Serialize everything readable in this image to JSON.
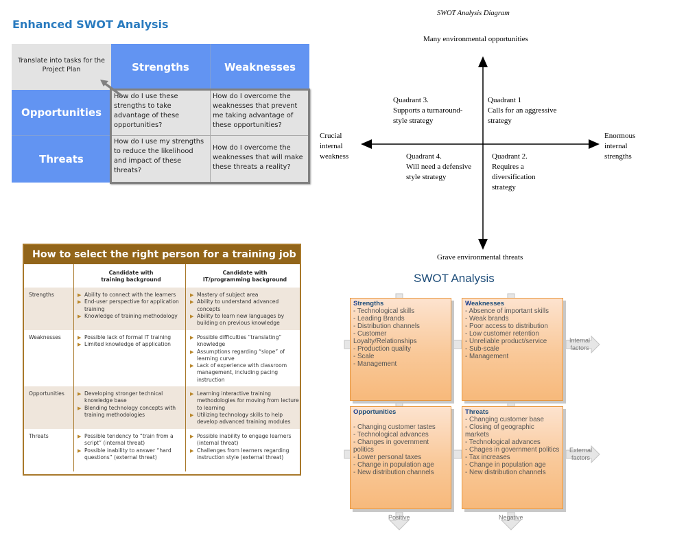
{
  "enhanced_swot": {
    "title": "Enhanced SWOT Analysis",
    "corner_note": "Translate into tasks for the Project Plan",
    "col_headers": [
      "Strengths",
      "Weaknesses"
    ],
    "row_headers": [
      "Opportunities",
      "Threats"
    ],
    "cells": {
      "strengths_opportunities": "How do I use these strengths to take advantage of these opportunities?",
      "weaknesses_opportunities": "How do I overcome the weaknesses that prevent me taking advantage of these opportunities?",
      "strengths_threats": "How do I use my strengths to reduce the likelihood and impact of these threats?",
      "weaknesses_threats": "How do I overcome the weaknesses that will make these threats a reality?"
    },
    "colors": {
      "header_blue": "#6294f2",
      "cell_grey": "#e3e3e3",
      "title_blue": "#2a7bbf"
    }
  },
  "swot_diagram": {
    "title": "SWOT Analysis Diagram",
    "axis_top": "Many environmental opportunities",
    "axis_bottom": "Grave environmental threats",
    "axis_left": [
      "Crucial",
      "internal",
      "weakness"
    ],
    "axis_right": [
      "Enormous",
      "internal",
      "strengths"
    ],
    "quadrants": {
      "q1": [
        "Quadrant 1",
        "Calls for an aggressive",
        "strategy"
      ],
      "q2": [
        "Quadrant 2.",
        "Requires a",
        "diversification",
        "strategy"
      ],
      "q3": [
        "Quadrant 3.",
        "Supports a turnaround-",
        "style strategy"
      ],
      "q4": [
        "Quadrant 4.",
        "Will need a defensive",
        "style strategy"
      ]
    }
  },
  "training_table": {
    "title": "How to select the right person for a training job",
    "col_headers": [
      [
        "Candidate with",
        "training background"
      ],
      [
        "Candidate with",
        "IT/programming background"
      ]
    ],
    "rows": [
      {
        "label": "Strengths",
        "training": [
          "Ability to connect with the learners",
          "End-user perspective for application training",
          "Knowledge of training methodology"
        ],
        "it": [
          "Mastery of subject area",
          "Ability to understand advanced concepts",
          "Ability to learn new languages by building on previous knowledge"
        ]
      },
      {
        "label": "Weaknesses",
        "training": [
          "Possible lack of formal IT training",
          "Limited knowledge of application"
        ],
        "it": [
          "Possible difficulties “translating” knowledge",
          "Assumptions regarding “slope” of learning curve",
          "Lack of experience with classroom management, including pacing instruction"
        ]
      },
      {
        "label": "Opportunities",
        "training": [
          "Developing stronger technical knowledge base",
          "Blending technology concepts with training methodologies"
        ],
        "it": [
          "Learning interactive training methodologies for moving from lecture to learning",
          "Utilizing technology skills to help develop advanced training modules"
        ]
      },
      {
        "label": "Threats",
        "training": [
          "Possible tendency to “train from a script” (internal threat)",
          "Possible inability to answer “hard questions” (external threat)"
        ],
        "it": [
          "Possible inability to engage learners (internal threat)",
          "Challenges from learners regarding instruction style (external threat)"
        ]
      }
    ],
    "colors": {
      "header_brown": "#92651a",
      "border": "#a8782a",
      "row_shade": "#efe6dc"
    }
  },
  "swot_analysis": {
    "title": "SWOT Analysis",
    "boxes": {
      "strengths": {
        "initial": "S",
        "rest": "trengths",
        "items": [
          "- Technological skills",
          "- Leading Brands",
          "- Distribution channels",
          "- Customer Loyalty/Relationships",
          "- Production quality",
          "- Scale",
          "- Management"
        ]
      },
      "weaknesses": {
        "initial": "W",
        "rest": "eaknesses",
        "items": [
          "- Absence of important skills",
          "- Weak brands",
          "- Poor access to distribution",
          "- Low customer retention",
          "- Unreliable product/service",
          "- Sub-scale",
          "- Management"
        ]
      },
      "opportunities": {
        "initial": "O",
        "rest": "pportunities",
        "items": [
          "",
          "- Changing customer tastes",
          "- Technological advances",
          "- Changes in government politics",
          "- Lower personal taxes",
          "- Change in population age",
          "- New distribution channels"
        ]
      },
      "threats": {
        "initial": "T",
        "rest": "hreats",
        "items": [
          "- Changing customer base",
          "- Closing of geographic markets",
          "- Technological advances",
          "- Chages in government politics",
          "- Tax increases",
          "- Change in population age",
          "- New distribution channels"
        ]
      }
    },
    "flow_labels": {
      "internal": [
        "Internal",
        "factors"
      ],
      "external": [
        "External",
        "factors"
      ],
      "positive": "Positive",
      "negative": "Negative"
    },
    "colors": {
      "box_border": "#e8953a",
      "box_fill_top": "#fde3cf",
      "box_fill_bottom": "#f7b97b",
      "title_blue": "#1f4e7a"
    }
  }
}
